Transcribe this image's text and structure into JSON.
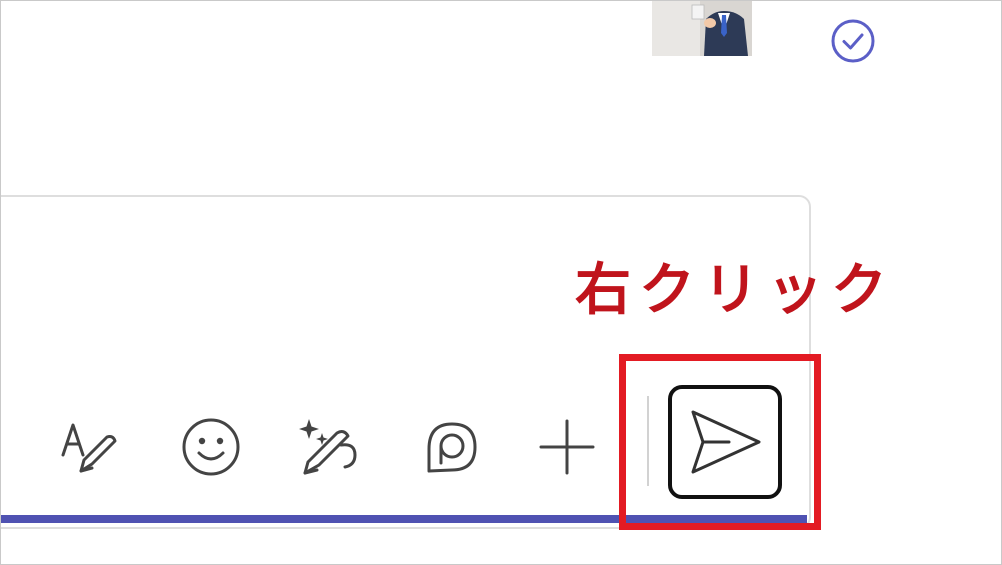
{
  "chat": {
    "message": {
      "avatar_icon": "user-avatar",
      "status_icon": "read-receipt-check-icon",
      "status_color": "#5b5fc7"
    }
  },
  "composer": {
    "accent_color": "#4f52b2",
    "toolbar": [
      {
        "name": "format-text-icon",
        "label": ""
      },
      {
        "name": "emoji-icon",
        "label": ""
      },
      {
        "name": "copilot-compose-icon",
        "label": ""
      },
      {
        "name": "loop-component-icon",
        "label": ""
      },
      {
        "name": "plus-icon",
        "label": ""
      }
    ],
    "send_icon": "send-icon"
  },
  "annotation": {
    "label": "右クリック",
    "color": "#c0141c",
    "target": "send-button"
  }
}
